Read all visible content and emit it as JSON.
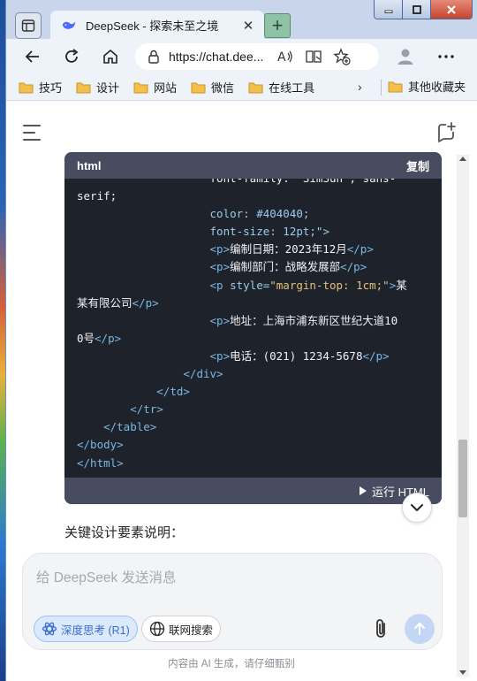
{
  "browser": {
    "tab_title": "DeepSeek - 探索未至之境",
    "tab_close": "✕",
    "new_tab": "+",
    "url": "https://chat.deepseek.com/",
    "url_display": "https://chat.dee..."
  },
  "bookmarks": {
    "items": [
      {
        "label": "技巧"
      },
      {
        "label": "设计"
      },
      {
        "label": "网站"
      },
      {
        "label": "微信"
      },
      {
        "label": "在线工具"
      }
    ],
    "more": "›",
    "other": "其他收藏夹"
  },
  "code": {
    "language": "html",
    "copy_label": "复制",
    "run_label": "运行 HTML",
    "lines": [
      [
        {
          "c": "c-text",
          "t": "                    font-family: 'SimSun', sans-"
        }
      ],
      [
        {
          "c": "c-text",
          "t": "serif;"
        }
      ],
      [
        {
          "c": "c-prop",
          "t": "                    color: #404040;"
        }
      ],
      [
        {
          "c": "c-prop",
          "t": "                    font-size: 12pt;\">"
        }
      ],
      [
        {
          "c": "c-tag",
          "t": "                    <p>"
        },
        {
          "c": "c-text",
          "t": "编制日期：2023年12月"
        },
        {
          "c": "c-tag",
          "t": "</p>"
        }
      ],
      [
        {
          "c": "c-tag",
          "t": "                    <p>"
        },
        {
          "c": "c-text",
          "t": "编制部门：战略发展部"
        },
        {
          "c": "c-tag",
          "t": "</p>"
        }
      ],
      [
        {
          "c": "c-tag",
          "t": "                    <p "
        },
        {
          "c": "c-attr",
          "t": "style="
        },
        {
          "c": "c-str",
          "t": "\"margin-top: 1cm;\""
        },
        {
          "c": "c-tag",
          "t": ">"
        },
        {
          "c": "c-text",
          "t": "某"
        }
      ],
      [
        {
          "c": "c-text",
          "t": "某有限公司"
        },
        {
          "c": "c-tag",
          "t": "</p>"
        }
      ],
      [
        {
          "c": "c-tag",
          "t": "                    <p>"
        },
        {
          "c": "c-text",
          "t": "地址：上海市浦东新区世纪大道10"
        }
      ],
      [
        {
          "c": "c-text",
          "t": "0号"
        },
        {
          "c": "c-tag",
          "t": "</p>"
        }
      ],
      [
        {
          "c": "c-tag",
          "t": "                    <p>"
        },
        {
          "c": "c-text",
          "t": "电话：(021) 1234-5678"
        },
        {
          "c": "c-tag",
          "t": "</p>"
        }
      ],
      [
        {
          "c": "c-tag",
          "t": "                </div>"
        }
      ],
      [
        {
          "c": "c-tag",
          "t": "            </td>"
        }
      ],
      [
        {
          "c": "c-tag",
          "t": "        </tr>"
        }
      ],
      [
        {
          "c": "c-tag",
          "t": "    </table>"
        }
      ],
      [
        {
          "c": "c-tag",
          "t": "</body>"
        }
      ],
      [
        {
          "c": "c-tag",
          "t": "</html>"
        }
      ]
    ]
  },
  "chat": {
    "section_title": "关键设计要素说明：",
    "input_placeholder": "给 DeepSeek 发送消息",
    "deep_think_label": "深度思考 (R1)",
    "web_search_label": "联网搜索",
    "disclaimer": "内容由 AI 生成，请仔细甄别"
  },
  "icons": {
    "tab_actions": "tab-actions-icon",
    "favicon": "deepseek-whale-icon",
    "back": "back-arrow-icon",
    "refresh": "refresh-icon",
    "home": "home-icon",
    "lock": "lock-icon",
    "read_aloud": "read-aloud-icon",
    "reader": "reader-mode-icon",
    "favorite": "add-favorite-icon",
    "profile": "profile-icon",
    "more": "more-icon",
    "menu": "menu-icon",
    "new_chat": "new-chat-icon",
    "attach": "paperclip-icon",
    "send": "send-arrow-icon"
  },
  "colors": {
    "code_bg": "#1e232b",
    "code_header": "#474c60",
    "accent": "#3a6fd1",
    "send_disabled": "#c4d6f5"
  }
}
